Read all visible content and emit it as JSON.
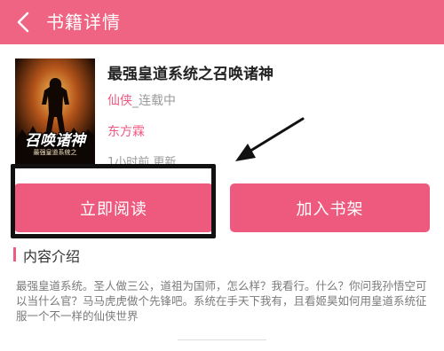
{
  "header": {
    "title": "书籍详情"
  },
  "book": {
    "cover_title": "召唤诸神",
    "cover_subtitle": "最强皇道系统之",
    "title": "最强皇道系统之召唤诸神",
    "genre": "仙侠",
    "status": "_连载中",
    "publisher": "东方霖",
    "update_time": "1小时前 更新"
  },
  "actions": {
    "read_label": "立即阅读",
    "add_shelf_label": "加入书架"
  },
  "intro": {
    "title": "内容介绍",
    "text": "最强皇道系统。圣人做三公，道祖为国师，怎么样？我看行。什么？你问我孙悟空可以当什么官？马马虎虎做个先锋吧。系统在手天下我有，且看姬昊如何用皇道系统征服一个不一样的仙侠世界"
  },
  "colors": {
    "accent": "#ef6482",
    "button": "#ee5a7e",
    "link": "#ee5a82",
    "annotation": "#111111"
  }
}
